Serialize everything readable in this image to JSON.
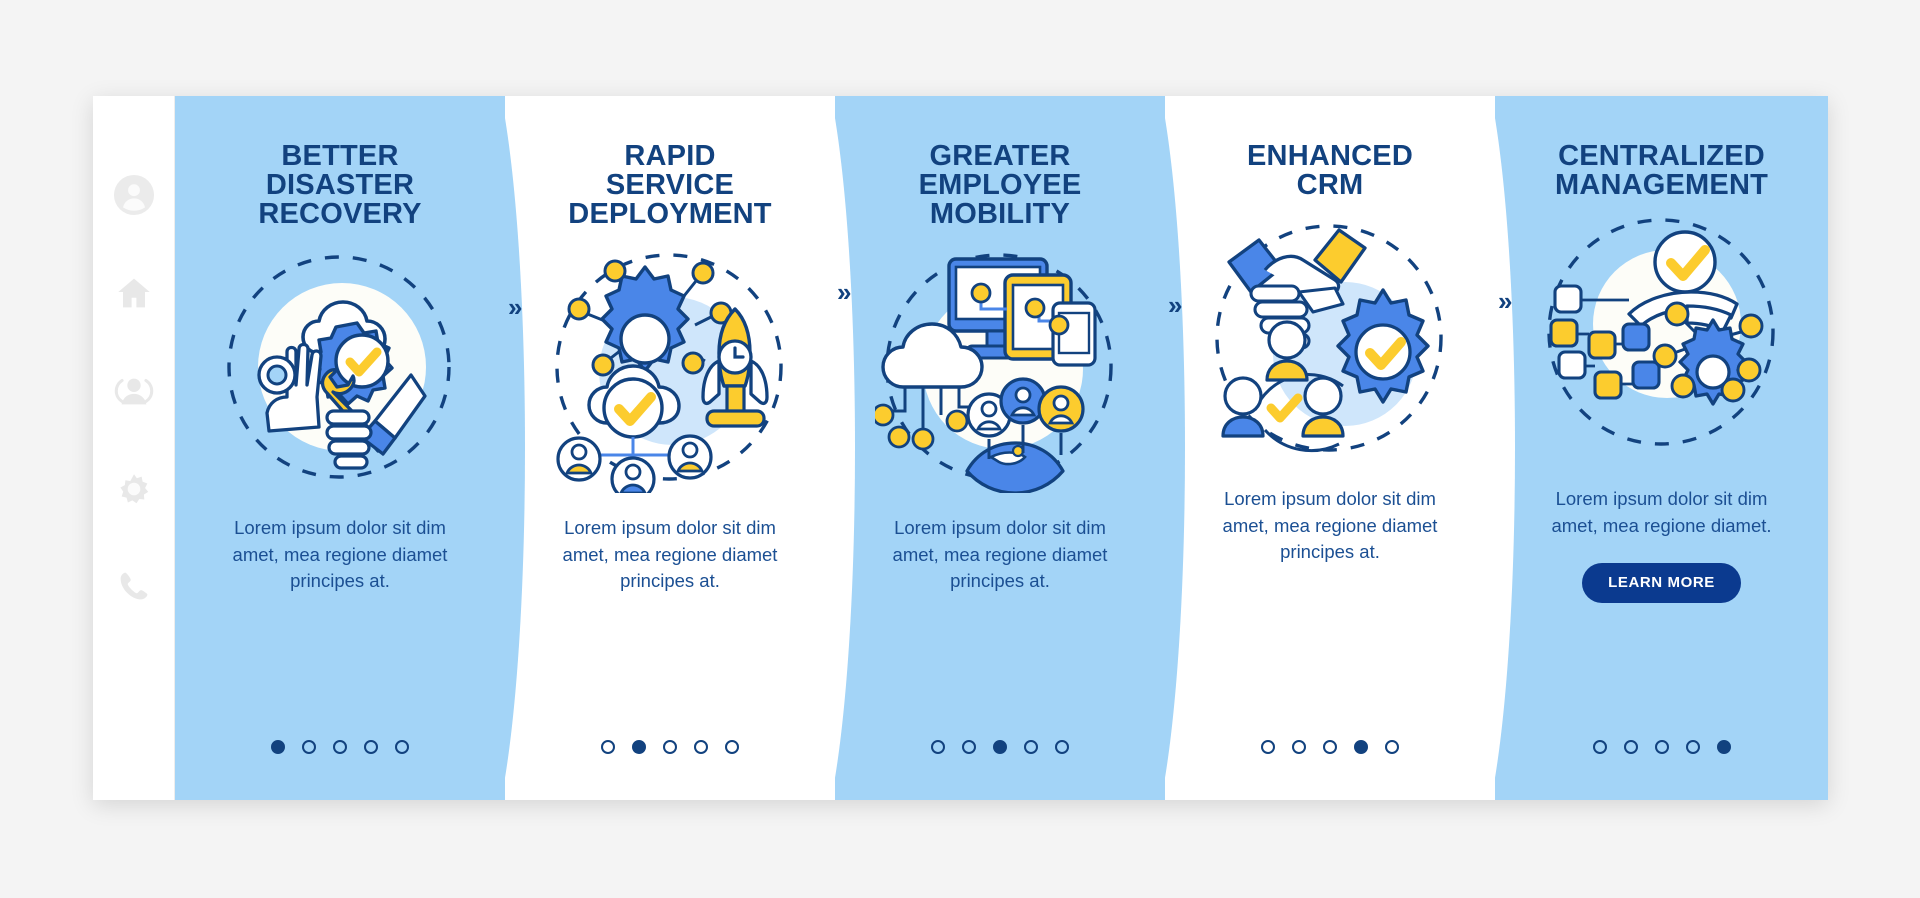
{
  "sidebar": {
    "items": [
      {
        "name": "account-avatar-icon",
        "icon": "user-circle"
      },
      {
        "name": "home-icon",
        "icon": "home"
      },
      {
        "name": "people-icon",
        "icon": "people"
      },
      {
        "name": "settings-gear-icon",
        "icon": "gear"
      },
      {
        "name": "phone-icon",
        "icon": "phone"
      }
    ]
  },
  "colors": {
    "panel_blue": "#a3d4f7",
    "panel_white": "#ffffff",
    "title_navy": "#12427f",
    "body_blue": "#1b4f93",
    "button_navy": "#0b3a8f",
    "accent_yellow": "#fccc2e",
    "accent_blue": "#4a86e8",
    "page_bg": "#f4f4f4"
  },
  "separator": {
    "glyph": "»",
    "label": "next-step-chevron"
  },
  "panels": [
    {
      "title": "BETTER\nDISASTER\nRECOVERY",
      "body": "Lorem ipsum dolor sit dim\namet, mea regione diamet\nprincipes at.",
      "theme": "blue",
      "art": "cloud-gear-check-handshake-wrench",
      "dots": {
        "count": 5,
        "active": 0
      },
      "button": null
    },
    {
      "title": "RAPID\nSERVICE\nDEPLOYMENT",
      "body": "Lorem ipsum dolor sit dim\namet, mea regione diamet\nprincipes at.",
      "theme": "white",
      "art": "gear-network-rocket-clock-cloud-users",
      "dots": {
        "count": 5,
        "active": 1
      },
      "button": null
    },
    {
      "title": "GREATER\nEMPLOYEE\nMOBILITY",
      "body": "Lorem ipsum dolor sit dim\namet, mea regione diamet\nprincipes at.",
      "theme": "blue",
      "art": "devices-cloud-globe-users",
      "dots": {
        "count": 5,
        "active": 2
      },
      "button": null
    },
    {
      "title": "ENHANCED\nCRM",
      "body": "Lorem ipsum dolor sit dim\namet, mea regione diamet\nprincipes at.",
      "theme": "white",
      "art": "handshake-gear-check-users",
      "dots": {
        "count": 5,
        "active": 3
      },
      "button": null
    },
    {
      "title": "CENTRALIZED\nMANAGEMENT",
      "body": "Lorem ipsum dolor sit dim\namet, mea regione diamet.",
      "theme": "blue",
      "art": "hand-check-nodes-gear-network",
      "dots": {
        "count": 5,
        "active": 4
      },
      "button": "LEARN MORE"
    }
  ]
}
